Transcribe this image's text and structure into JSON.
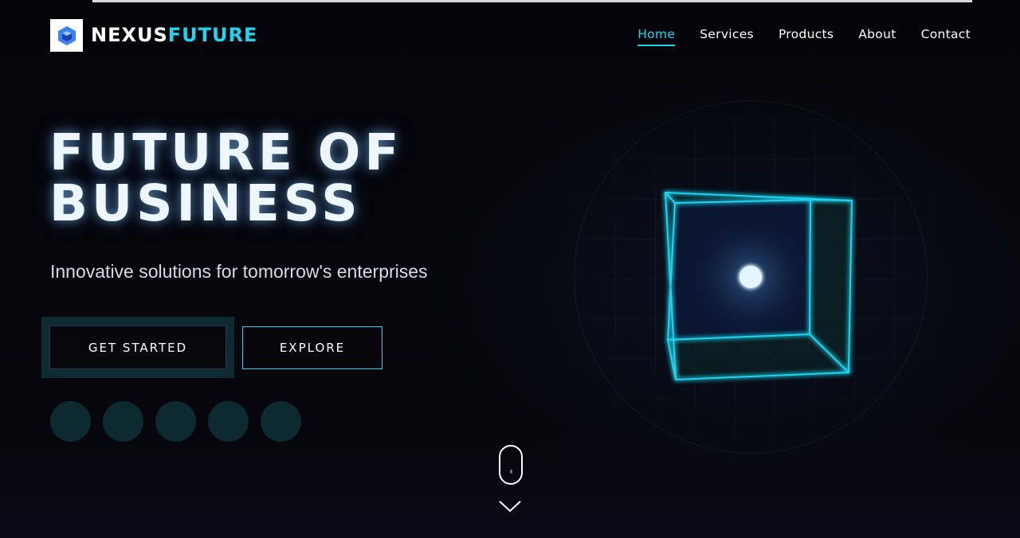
{
  "brand": {
    "name_part1": "NEXUS",
    "name_part2": "FUTURE",
    "logo_icon": "hexagon-cube-icon",
    "accent_color": "#22d3ee"
  },
  "nav": {
    "items": [
      {
        "label": "Home",
        "active": true
      },
      {
        "label": "Services",
        "active": false
      },
      {
        "label": "Products",
        "active": false
      },
      {
        "label": "About",
        "active": false
      },
      {
        "label": "Contact",
        "active": false
      }
    ]
  },
  "hero": {
    "title_line1": "FUTURE OF",
    "title_line2": "BUSINESS",
    "subtitle": "Innovative solutions for tomorrow's enterprises",
    "primary_button": "GET STARTED",
    "secondary_button": "EXPLORE"
  },
  "carousel": {
    "dot_count": 5
  },
  "visual": {
    "cube_icon": "wireframe-cube",
    "scroll_icon": "mouse-scroll-icon",
    "down_icon": "chevron-down-icon"
  }
}
